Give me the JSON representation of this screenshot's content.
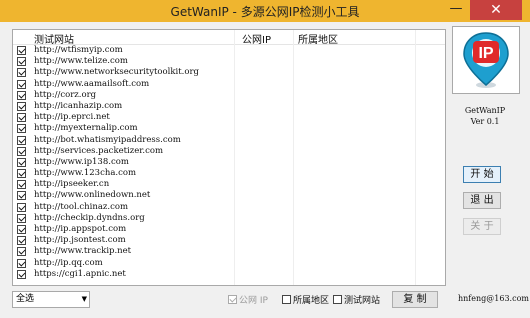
{
  "window": {
    "title": "GetWanIP - 多源公网IP检测小工具",
    "minimize_glyph": "—",
    "close_glyph": "✕"
  },
  "list": {
    "headers": {
      "site": "测试网站",
      "ip": "公网IP",
      "region": "所属地区"
    },
    "rows": [
      "http://wtfismyip.com",
      "http://www.telize.com",
      "http://www.networksecuritytoolkit.org",
      "http://www.aamailsoft.com",
      "http://corz.org",
      "http://icanhazip.com",
      "http://ip.eprci.net",
      "http://myexternalip.com",
      "http://bot.whatismyipaddress.com",
      "http://services.packetizer.com",
      "http://www.ip138.com",
      "http://www.123cha.com",
      "http://ipseeker.cn",
      "http://www.onlinedown.net",
      "http://tool.chinaz.com",
      "http://checkip.dyndns.org",
      "http://ip.appspot.com",
      "http://ip.jsontest.com",
      "http://www.trackip.net",
      "http://ip.qq.com",
      "https://cgi1.apnic.net"
    ]
  },
  "logo": {
    "text": "IP",
    "colors": {
      "pin": "#1e9fcf",
      "badge": "#e02a2a"
    }
  },
  "app": {
    "name": "GetWanIP",
    "version": "Ver 0.1"
  },
  "buttons": {
    "start": "开 始",
    "exit": "退 出",
    "about": "关 于",
    "copy": "复 制"
  },
  "footer": {
    "select_value": "全选",
    "select_arrow": "▼",
    "opt_ip": "公网 IP",
    "opt_region": "所属地区",
    "opt_site": "测试网站",
    "email": "hnfeng@163.com"
  }
}
